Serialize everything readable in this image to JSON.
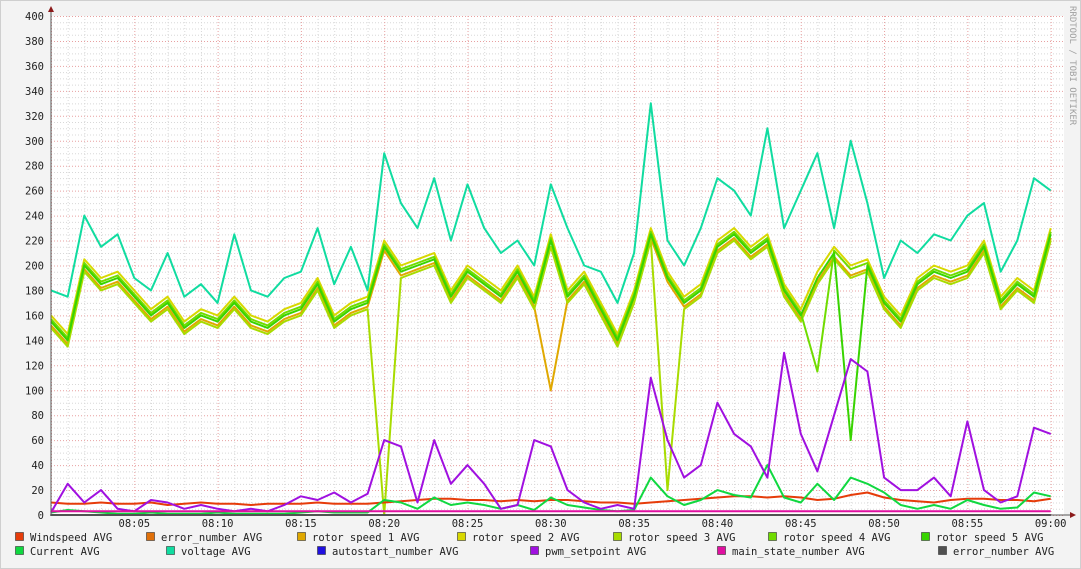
{
  "chart_data": {
    "type": "line",
    "watermark": "RRDTOOL / TOBI OETIKER",
    "ylim": [
      0,
      400
    ],
    "y_ticks": [
      0,
      20,
      40,
      60,
      80,
      100,
      120,
      140,
      160,
      180,
      200,
      220,
      240,
      260,
      280,
      300,
      320,
      340,
      360,
      380,
      400
    ],
    "x_unit": "minutes after 08:00",
    "xlim": [
      0,
      60.8
    ],
    "x_ticks": [
      {
        "value": 5,
        "label": "08:05"
      },
      {
        "value": 10,
        "label": "08:10"
      },
      {
        "value": 15,
        "label": "08:15"
      },
      {
        "value": 20,
        "label": "08:20"
      },
      {
        "value": 25,
        "label": "08:25"
      },
      {
        "value": 30,
        "label": "08:30"
      },
      {
        "value": 35,
        "label": "08:35"
      },
      {
        "value": 40,
        "label": "08:40"
      },
      {
        "value": 45,
        "label": "08:45"
      },
      {
        "value": 50,
        "label": "08:50"
      },
      {
        "value": 55,
        "label": "08:55"
      },
      {
        "value": 60,
        "label": "09:00"
      }
    ],
    "grid": true,
    "legend_position": "bottom",
    "x": [
      0,
      1,
      2,
      3,
      4,
      5,
      6,
      7,
      8,
      9,
      10,
      11,
      12,
      13,
      14,
      15,
      16,
      17,
      18,
      19,
      20,
      21,
      22,
      23,
      24,
      25,
      26,
      27,
      28,
      29,
      30,
      31,
      32,
      33,
      34,
      35,
      36,
      37,
      38,
      39,
      40,
      41,
      42,
      43,
      44,
      45,
      46,
      47,
      48,
      49,
      50,
      51,
      52,
      53,
      54,
      55,
      56,
      57,
      58,
      59,
      60
    ],
    "series": [
      {
        "name": "Windspeed AVG",
        "color": "#e63c0a",
        "values": [
          10,
          9,
          9,
          10,
          9,
          9,
          10,
          8,
          9,
          10,
          9,
          9,
          8,
          9,
          9,
          9,
          10,
          9,
          9,
          9,
          10,
          11,
          12,
          13,
          13,
          12,
          12,
          11,
          12,
          11,
          12,
          12,
          11,
          10,
          10,
          9,
          10,
          11,
          12,
          13,
          14,
          15,
          15,
          14,
          15,
          14,
          12,
          13,
          16,
          18,
          14,
          12,
          11,
          10,
          12,
          13,
          13,
          12,
          12,
          11,
          13
        ]
      },
      {
        "name": "error_number AVG",
        "color": "#e0700a",
        "values": [
          0,
          0,
          0,
          0,
          0,
          0,
          0,
          0,
          0,
          0,
          0,
          0,
          0,
          0,
          0,
          0,
          0,
          0,
          0,
          0,
          0,
          0,
          0,
          0,
          0,
          0,
          0,
          0,
          0,
          0,
          0,
          0,
          0,
          0,
          0,
          0,
          0,
          0,
          0,
          0,
          0,
          0,
          0,
          0,
          0,
          0,
          0,
          0,
          0,
          0,
          0,
          0,
          0,
          0,
          0,
          0,
          0,
          0,
          0,
          0,
          0
        ]
      },
      {
        "name": "rotor speed 1 AVG",
        "color": "#e0a800",
        "values": [
          152,
          137,
          197,
          182,
          187,
          172,
          157,
          167,
          147,
          157,
          152,
          167,
          152,
          147,
          157,
          162,
          182,
          152,
          162,
          167,
          212,
          192,
          197,
          202,
          172,
          192,
          182,
          172,
          192,
          167,
          100,
          172,
          187,
          162,
          137,
          172,
          222,
          187,
          167,
          177,
          212,
          222,
          207,
          217,
          177,
          157,
          187,
          207,
          192,
          197,
          167,
          152,
          182,
          192,
          187,
          192,
          212,
          167,
          182,
          172,
          222
        ]
      },
      {
        "name": "rotor speed 2 AVG",
        "color": "#d8d800",
        "values": [
          160,
          145,
          205,
          190,
          195,
          180,
          165,
          175,
          155,
          165,
          160,
          175,
          160,
          155,
          165,
          170,
          190,
          160,
          170,
          175,
          220,
          200,
          205,
          210,
          180,
          200,
          190,
          180,
          200,
          175,
          225,
          180,
          195,
          170,
          145,
          180,
          230,
          195,
          175,
          185,
          220,
          230,
          215,
          225,
          185,
          165,
          195,
          215,
          200,
          205,
          175,
          160,
          190,
          200,
          195,
          200,
          220,
          175,
          190,
          180,
          230
        ]
      },
      {
        "name": "rotor speed 3 AVG",
        "color": "#a8dc00",
        "values": [
          150,
          135,
          195,
          180,
          185,
          170,
          155,
          165,
          145,
          155,
          150,
          165,
          150,
          145,
          155,
          160,
          180,
          150,
          160,
          165,
          0,
          190,
          195,
          200,
          170,
          190,
          180,
          170,
          190,
          165,
          215,
          170,
          185,
          160,
          135,
          170,
          220,
          20,
          165,
          175,
          210,
          220,
          205,
          215,
          175,
          155,
          185,
          205,
          190,
          195,
          165,
          150,
          180,
          190,
          185,
          190,
          210,
          165,
          180,
          170,
          220
        ]
      },
      {
        "name": "rotor speed 4 AVG",
        "color": "#70dc00",
        "values": [
          157,
          142,
          202,
          187,
          192,
          177,
          162,
          172,
          152,
          162,
          157,
          172,
          157,
          152,
          162,
          167,
          187,
          157,
          167,
          172,
          217,
          197,
          202,
          207,
          177,
          197,
          187,
          177,
          197,
          172,
          222,
          177,
          192,
          167,
          142,
          177,
          227,
          192,
          172,
          182,
          217,
          227,
          212,
          222,
          182,
          162,
          115,
          212,
          197,
          202,
          172,
          157,
          187,
          197,
          192,
          197,
          217,
          172,
          187,
          177,
          227
        ]
      },
      {
        "name": "rotor speed 5 AVG",
        "color": "#38d400",
        "values": [
          155,
          140,
          200,
          185,
          190,
          175,
          160,
          170,
          150,
          160,
          155,
          170,
          155,
          150,
          160,
          165,
          185,
          155,
          165,
          170,
          215,
          195,
          200,
          205,
          175,
          195,
          185,
          175,
          195,
          170,
          220,
          175,
          190,
          165,
          140,
          175,
          225,
          190,
          170,
          180,
          215,
          225,
          210,
          220,
          180,
          160,
          190,
          210,
          60,
          200,
          170,
          155,
          185,
          195,
          190,
          195,
          215,
          170,
          185,
          175,
          225
        ]
      },
      {
        "name": "Current AVG",
        "color": "#10d840",
        "values": [
          2,
          4,
          3,
          2,
          1,
          1,
          2,
          1,
          1,
          1,
          2,
          1,
          1,
          1,
          1,
          2,
          3,
          2,
          2,
          2,
          12,
          10,
          5,
          14,
          8,
          10,
          8,
          5,
          8,
          4,
          14,
          8,
          6,
          4,
          3,
          4,
          30,
          15,
          8,
          12,
          20,
          16,
          14,
          40,
          14,
          10,
          25,
          12,
          30,
          25,
          18,
          8,
          5,
          8,
          5,
          12,
          8,
          5,
          6,
          18,
          15
        ]
      },
      {
        "name": "voltage AVG",
        "color": "#10dca0",
        "values": [
          180,
          175,
          240,
          215,
          225,
          190,
          180,
          210,
          175,
          185,
          170,
          225,
          180,
          175,
          190,
          195,
          230,
          185,
          215,
          180,
          290,
          250,
          230,
          270,
          220,
          265,
          230,
          210,
          220,
          200,
          265,
          230,
          200,
          195,
          170,
          210,
          330,
          220,
          200,
          230,
          270,
          260,
          240,
          310,
          230,
          260,
          290,
          230,
          300,
          250,
          190,
          220,
          210,
          225,
          220,
          240,
          250,
          195,
          220,
          270,
          260
        ]
      },
      {
        "name": "autostart_number AVG",
        "color": "#2010e0",
        "values": [
          0,
          0,
          0,
          0,
          0,
          0,
          0,
          0,
          0,
          0,
          0,
          0,
          0,
          0,
          0,
          0,
          0,
          0,
          0,
          0,
          0,
          0,
          0,
          0,
          0,
          0,
          0,
          0,
          0,
          0,
          0,
          0,
          0,
          0,
          0,
          0,
          0,
          0,
          0,
          0,
          0,
          0,
          0,
          0,
          0,
          0,
          0,
          0,
          0,
          0,
          0,
          0,
          0,
          0,
          0,
          0,
          0,
          0,
          0,
          0,
          0
        ]
      },
      {
        "name": "pwm_setpoint AVG",
        "color": "#a010e0",
        "values": [
          2,
          25,
          10,
          20,
          5,
          3,
          12,
          10,
          5,
          8,
          5,
          3,
          5,
          3,
          8,
          15,
          12,
          18,
          10,
          17,
          60,
          55,
          10,
          60,
          25,
          40,
          25,
          5,
          8,
          60,
          55,
          20,
          10,
          5,
          8,
          5,
          110,
          60,
          30,
          40,
          90,
          65,
          55,
          30,
          130,
          65,
          35,
          80,
          125,
          115,
          30,
          20,
          20,
          30,
          15,
          75,
          20,
          10,
          15,
          70,
          65
        ]
      },
      {
        "name": "main_state_number AVG",
        "color": "#e010a0",
        "values": [
          3,
          3,
          3,
          3,
          3,
          3,
          3,
          3,
          3,
          3,
          3,
          3,
          3,
          3,
          3,
          3,
          3,
          3,
          3,
          3,
          3,
          3,
          3,
          3,
          3,
          3,
          3,
          3,
          3,
          3,
          3,
          3,
          3,
          3,
          3,
          3,
          3,
          3,
          3,
          3,
          3,
          3,
          3,
          3,
          3,
          3,
          3,
          3,
          3,
          3,
          3,
          3,
          3,
          3,
          3,
          3,
          3,
          3,
          3,
          3,
          3
        ]
      },
      {
        "name": "error_number AVG",
        "color": "#505050",
        "values": [
          0,
          0,
          0,
          0,
          0,
          0,
          0,
          0,
          0,
          0,
          0,
          0,
          0,
          0,
          0,
          0,
          0,
          0,
          0,
          0,
          0,
          0,
          0,
          0,
          0,
          0,
          0,
          0,
          0,
          0,
          0,
          0,
          0,
          0,
          0,
          0,
          0,
          0,
          0,
          0,
          0,
          0,
          0,
          0,
          0,
          0,
          0,
          0,
          0,
          0,
          0,
          0,
          0,
          0,
          0,
          0,
          0,
          0,
          0,
          0,
          0
        ]
      }
    ]
  }
}
